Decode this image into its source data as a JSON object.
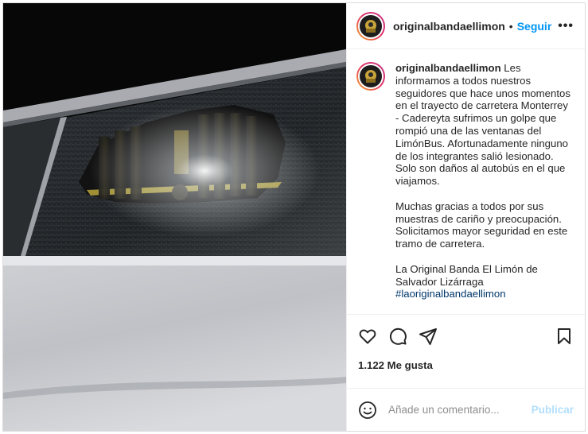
{
  "post": {
    "image_alt": "car window smashed at night"
  },
  "header": {
    "username": "originalbandaellimon",
    "separator": "•",
    "follow_label": "Seguir",
    "more_label": "•••",
    "avatar_icon": "band-logo-avatar"
  },
  "caption": {
    "username": "originalbandaellimon",
    "paragraph_1": "Les informamos a todos nuestros seguidores que hace unos momentos en el trayecto de carretera Monterrey - Cadereyta sufrimos un golpe que rompió una de las ventanas del LimónBus. Afortunadamente ninguno de los integrantes salió lesionado. Solo son daños al autobús en el que viajamos.",
    "paragraph_2_line_1": "Muchas gracias a todos por sus muestras de cariño y preocupación.",
    "paragraph_2_line_2": "Solicitamos mayor seguridad en este tramo de carretera.",
    "paragraph_3": "La Original Banda El Limón de Salvador Lizárraga ",
    "hashtag": "#laoriginalbandaellimon"
  },
  "actions": {
    "like_icon": "heart-icon",
    "comment_icon": "comment-bubble-icon",
    "share_icon": "paper-plane-icon",
    "save_icon": "bookmark-icon",
    "likes_text": "1.122 Me gusta"
  },
  "comment_bar": {
    "emoji_icon": "smiley-icon",
    "placeholder": "Añade un comentario...",
    "publish_label": "Publicar",
    "publish_color": "#b2dffc"
  },
  "colors": {
    "accent": "#0095f6",
    "hashtag": "#00376b",
    "border": "#dbdbdb"
  }
}
